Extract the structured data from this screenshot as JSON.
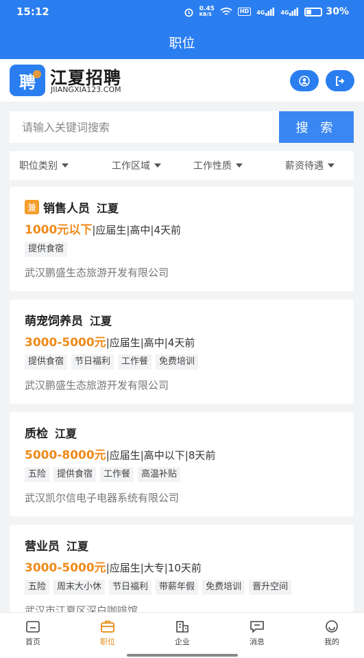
{
  "status_bar": {
    "time": "15:12",
    "net_speed": "0.45",
    "net_unit": "KB/S",
    "hd": "HD",
    "signal1": "4G",
    "signal2": "4G",
    "battery": "30%"
  },
  "header": {
    "title": "职位"
  },
  "brand": {
    "logo_char": "聘",
    "name": "江夏招聘",
    "domain": "JIIANGXIA123.COM"
  },
  "search": {
    "placeholder": "请输入关键词搜索",
    "button": "搜 索"
  },
  "filters": [
    {
      "label": "职位类别"
    },
    {
      "label": "工作区域"
    },
    {
      "label": "工作性质"
    },
    {
      "label": "薪资待遇"
    }
  ],
  "jobs": [
    {
      "badge": "兼",
      "title": "销售人员",
      "location": "江夏",
      "salary": "1000元以下",
      "meta": "|应届生|高中|4天前",
      "tags": [
        "提供食宿"
      ],
      "company": "武汉鹏盛生态旅游开发有限公司"
    },
    {
      "badge": "",
      "title": "萌宠饲养员",
      "location": "江夏",
      "salary": "3000-5000元",
      "meta": "|应届生|高中|4天前",
      "tags": [
        "提供食宿",
        "节日福利",
        "工作餐",
        "免费培训"
      ],
      "company": "武汉鹏盛生态旅游开发有限公司"
    },
    {
      "badge": "",
      "title": "质检",
      "location": "江夏",
      "salary": "5000-8000元",
      "meta": "|应届生|高中以下|8天前",
      "tags": [
        "五险",
        "提供食宿",
        "工作餐",
        "高温补贴"
      ],
      "company": "武汉凯尔信电子电器系统有限公司"
    },
    {
      "badge": "",
      "title": "营业员",
      "location": "江夏",
      "salary": "3000-5000元",
      "meta": "|应届生|大专|10天前",
      "tags": [
        "五险",
        "周末大小休",
        "节日福利",
        "带薪年假",
        "免费培训",
        "晋升空间"
      ],
      "company": "武汉市江夏区深白咖啡馆"
    }
  ],
  "bottom_nav": [
    {
      "label": "首页",
      "icon": "home-icon"
    },
    {
      "label": "职位",
      "icon": "briefcase-icon"
    },
    {
      "label": "企业",
      "icon": "building-icon"
    },
    {
      "label": "消息",
      "icon": "message-icon"
    },
    {
      "label": "我的",
      "icon": "profile-icon"
    }
  ],
  "colors": {
    "primary": "#2b7ef0",
    "accent": "#f08a1a"
  }
}
